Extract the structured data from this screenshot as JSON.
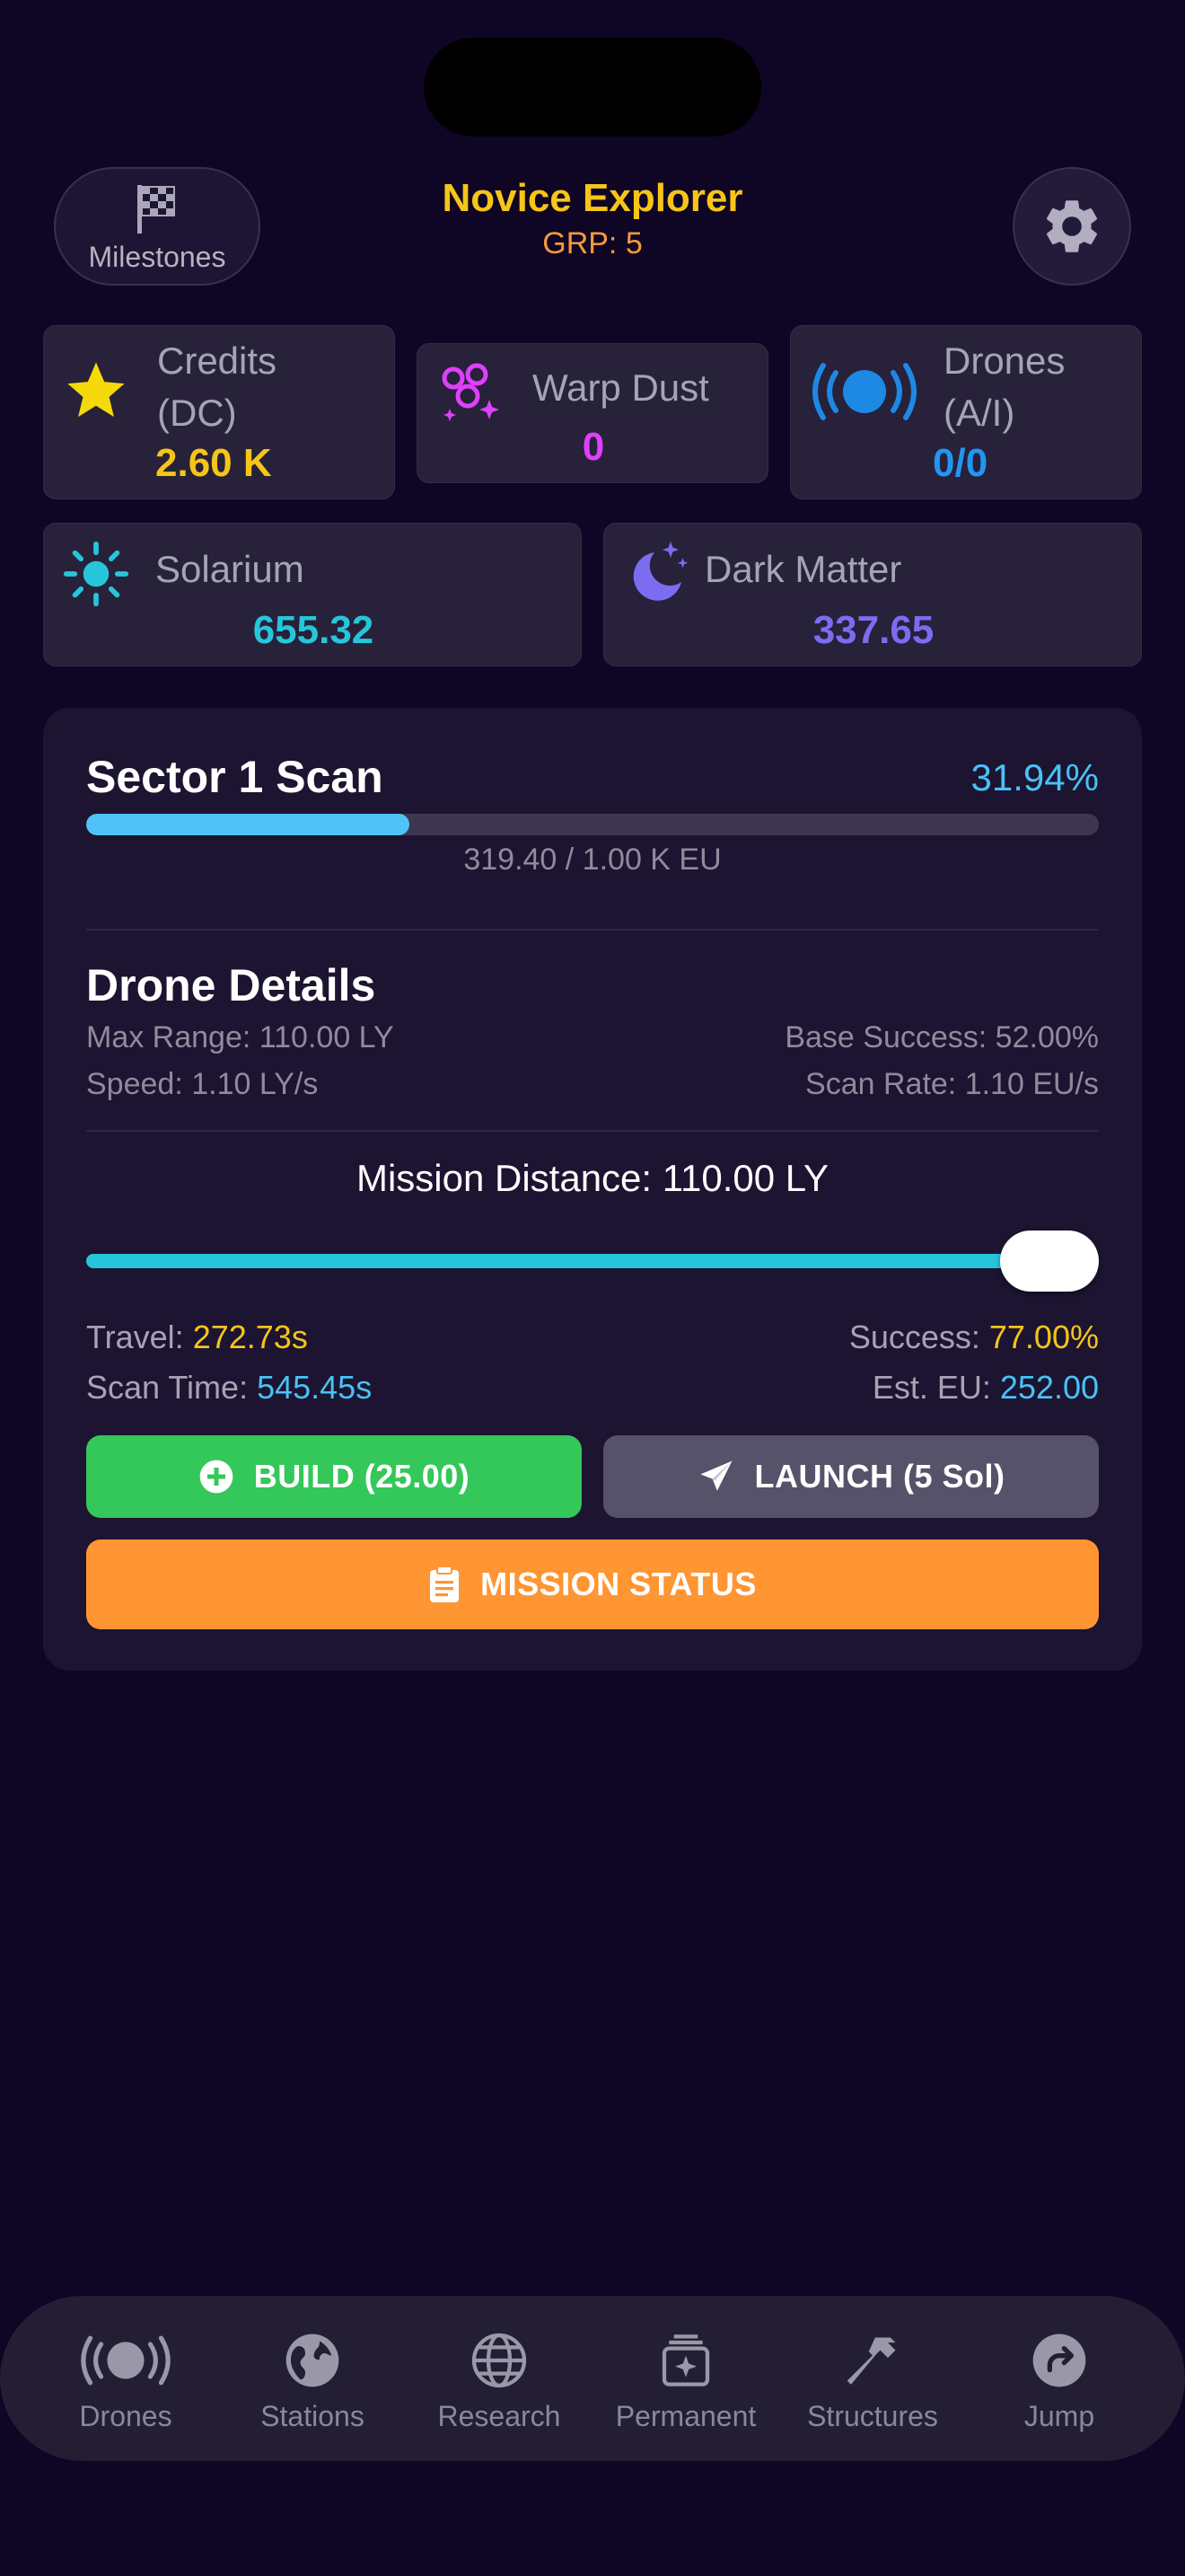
{
  "header": {
    "milestones_label": "Milestones",
    "title": "Novice Explorer",
    "grp": "GRP: 5"
  },
  "resources": {
    "credits": {
      "name_line1": "Credits",
      "name_line2": "(DC)",
      "value": "2.60 K",
      "color": "#f5c518"
    },
    "warp_dust": {
      "name": "Warp Dust",
      "value": "0",
      "color": "#e040fb"
    },
    "drones": {
      "name_line1": "Drones",
      "name_line2": "(A/I)",
      "value": "0/0",
      "color": "#2196f3"
    },
    "solarium": {
      "name": "Solarium",
      "value": "655.32",
      "color": "#26c6da"
    },
    "dark_matter": {
      "name": "Dark Matter",
      "value": "337.65",
      "color": "#7c6cf0"
    }
  },
  "scan": {
    "title": "Sector 1 Scan",
    "percent_label": "31.94%",
    "progress": 0.3194,
    "progress_text": "319.40 / 1.00 K EU"
  },
  "drone_details": {
    "title": "Drone Details",
    "max_range": "Max Range: 110.00 LY",
    "speed": "Speed: 1.10 LY/s",
    "base_success": "Base Success: 52.00%",
    "scan_rate": "Scan Rate: 1.10 EU/s"
  },
  "mission": {
    "distance_label": "Mission Distance: 110.00 LY",
    "distance_fraction": 1.0,
    "travel_label": "Travel:",
    "travel_value": "272.73s",
    "scan_time_label": "Scan Time:",
    "scan_time_value": "545.45s",
    "success_label": "Success:",
    "success_value": "77.00%",
    "est_eu_label": "Est. EU:",
    "est_eu_value": "252.00"
  },
  "buttons": {
    "build": "BUILD (25.00)",
    "launch": "LAUNCH (5 Sol)",
    "mission_status": "MISSION STATUS"
  },
  "tabs": [
    {
      "label": "Drones",
      "icon": "drone-icon"
    },
    {
      "label": "Stations",
      "icon": "globe-icon"
    },
    {
      "label": "Research",
      "icon": "network-globe-icon"
    },
    {
      "label": "Permanent",
      "icon": "upgrade-stack-icon"
    },
    {
      "label": "Structures",
      "icon": "hammer-icon"
    },
    {
      "label": "Jump",
      "icon": "jump-arrow-icon"
    }
  ],
  "colors": {
    "background": "#0f0524",
    "build_button": "#34c759",
    "launch_button": "#55526a",
    "mission_status_button": "#ff9533",
    "progress": "#4fc3f7",
    "slider": "#26c6da"
  }
}
